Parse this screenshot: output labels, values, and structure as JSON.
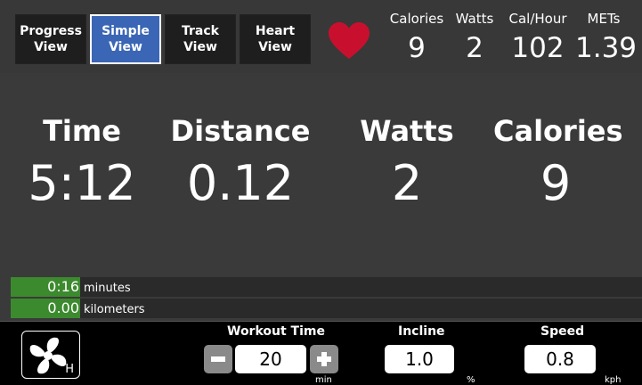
{
  "tabs": [
    {
      "line1": "Progress",
      "line2": "View",
      "active": false
    },
    {
      "line1": "Simple",
      "line2": "View",
      "active": true
    },
    {
      "line1": "Track",
      "line2": "View",
      "active": false
    },
    {
      "line1": "Heart",
      "line2": "View",
      "active": false
    }
  ],
  "header_stats": {
    "calories": {
      "label": "Calories",
      "value": "9"
    },
    "watts": {
      "label": "Watts",
      "value": "2"
    },
    "cal_hour": {
      "label": "Cal/Hour",
      "value": "102"
    },
    "mets": {
      "label": "METs",
      "value": "1.39"
    }
  },
  "metrics": {
    "time": {
      "label": "Time",
      "value": "5:12"
    },
    "distance": {
      "label": "Distance",
      "value": "0.12"
    },
    "watts": {
      "label": "Watts",
      "value": "2"
    },
    "calories": {
      "label": "Calories",
      "value": "9"
    }
  },
  "progress": {
    "minutes": {
      "value": "0:16",
      "unit": "minutes",
      "fraction": 0.11
    },
    "kilometers": {
      "value": "0.00",
      "unit": "kilometers",
      "fraction": 0.11
    }
  },
  "controls": {
    "fan_label": "H",
    "workout_time": {
      "label": "Workout Time",
      "value": "20",
      "unit": "min"
    },
    "incline": {
      "label": "Incline",
      "value": "1.0",
      "unit": "%"
    },
    "speed": {
      "label": "Speed",
      "value": "0.8",
      "unit": "kph"
    }
  },
  "colors": {
    "active_tab": "#3a66b5",
    "progress_fill": "#3c8a2e",
    "heart": "#c8102e",
    "background": "#3a3a3a"
  },
  "icons": {
    "heart": "heart-icon",
    "fan": "fan-icon",
    "minus": "minus-icon",
    "plus": "plus-icon"
  }
}
